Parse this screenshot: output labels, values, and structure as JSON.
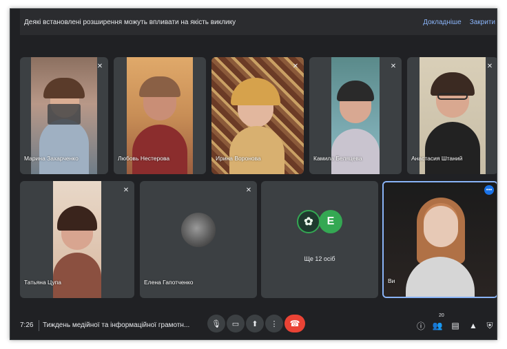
{
  "banner": {
    "message": "Деякі встановлені розширення можуть впливати на якість виклику",
    "learn_more": "Докладніше",
    "close": "Закрити"
  },
  "participants": [
    {
      "name": "Марина Захарченко"
    },
    {
      "name": "Любовь Нестерова"
    },
    {
      "name": "Ирина Воронова"
    },
    {
      "name": "Камила Беляцева"
    },
    {
      "name": "Анастасия Штаний"
    },
    {
      "name": "Татьяна Цупа"
    },
    {
      "name": "Елена Гапотченко"
    },
    {
      "name": "Ви"
    }
  ],
  "more_tile": {
    "label": "Ще 12 осіб",
    "avatar_letter": "E",
    "avatar_color": "#34a853",
    "avatar_ring": "#1e8e3e"
  },
  "controls": {
    "time": "7:26",
    "meeting_title": "Тиждень медійної та інформаційної грамотн...",
    "participant_count": "20"
  },
  "colors": {
    "background": "#202124",
    "tile": "#3c4043",
    "accent": "#8ab4f8",
    "hangup": "#ea4335",
    "self_highlight": "#8ab4f8"
  },
  "icons": [
    "mic-off-icon",
    "mic-icon",
    "camera-icon",
    "present-icon",
    "more-vert-icon",
    "call-end-icon",
    "info-icon",
    "people-icon",
    "chat-icon",
    "activities-icon",
    "host-controls-icon"
  ]
}
